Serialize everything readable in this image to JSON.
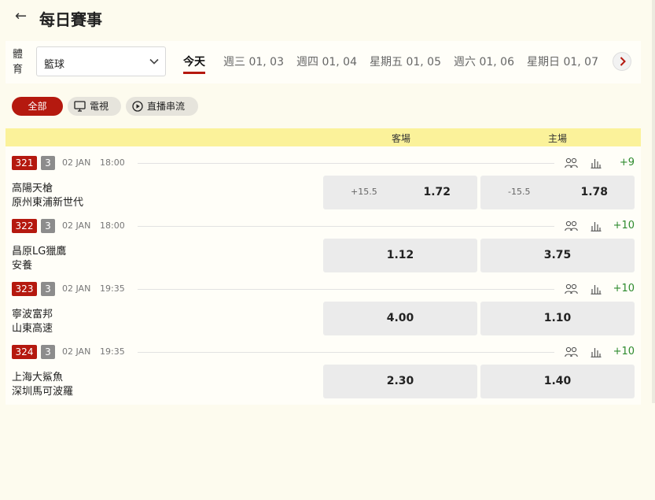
{
  "header": {
    "back_icon": "arrow-left-icon",
    "title": "每日賽事"
  },
  "sport": {
    "label": "體育",
    "selected": "籃球"
  },
  "date_tabs": [
    {
      "label": "今天",
      "active": true
    },
    {
      "label": "週三 01, 03",
      "active": false
    },
    {
      "label": "週四 01, 04",
      "active": false
    },
    {
      "label": "星期五 01, 05",
      "active": false
    },
    {
      "label": "週六 01, 06",
      "active": false
    },
    {
      "label": "星期日 01, 07",
      "active": false
    }
  ],
  "filters": {
    "all": "全部",
    "tv": "電視",
    "stream": "直播串流"
  },
  "columns": {
    "away": "客場",
    "home": "主場"
  },
  "colors": {
    "accent": "#b5190f",
    "header_bg": "#fbf29a",
    "page_bg": "#fdfbee",
    "more_text": "#2e8b2e"
  },
  "matches": [
    {
      "id": "321",
      "count": "3",
      "date": "02 JAN",
      "time": "18:00",
      "more": "+9",
      "team1": "高陽天槍",
      "team2": "原州東浦新世代",
      "away_hcp": "+15.5",
      "away_odds": "1.72",
      "home_hcp": "-15.5",
      "home_odds": "1.78"
    },
    {
      "id": "322",
      "count": "3",
      "date": "02 JAN",
      "time": "18:00",
      "more": "+10",
      "team1": "昌原LG獵鷹",
      "team2": "安養",
      "away_odds": "1.12",
      "home_odds": "3.75"
    },
    {
      "id": "323",
      "count": "3",
      "date": "02 JAN",
      "time": "19:35",
      "more": "+10",
      "team1": "寧波富邦",
      "team2": "山東高速",
      "away_odds": "4.00",
      "home_odds": "1.10"
    },
    {
      "id": "324",
      "count": "3",
      "date": "02 JAN",
      "time": "19:35",
      "more": "+10",
      "team1": "上海大鯊魚",
      "team2": "深圳馬可波羅",
      "away_odds": "2.30",
      "home_odds": "1.40"
    }
  ]
}
